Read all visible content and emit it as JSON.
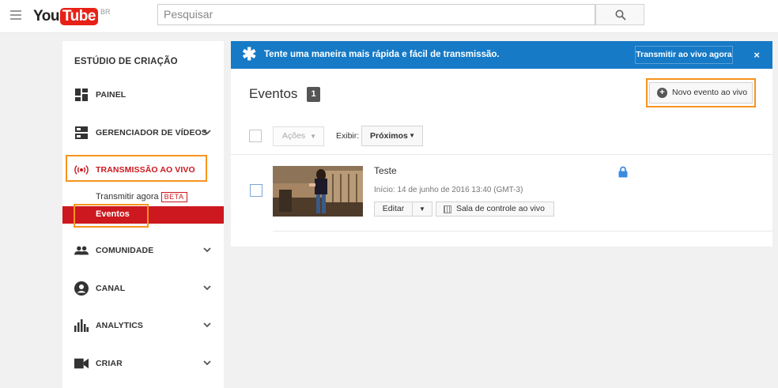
{
  "header": {
    "logo_you": "You",
    "logo_tube": "Tube",
    "logo_country": "BR",
    "search_placeholder": "Pesquisar"
  },
  "sidebar": {
    "title": "ESTÚDIO DE CRIAÇÃO",
    "items": [
      {
        "label": "PAINEL",
        "icon": "dashboard-icon",
        "chevron": false
      },
      {
        "label": "GERENCIADOR DE VÍDEOS",
        "icon": "video-manager-icon",
        "chevron": true
      },
      {
        "label": "TRANSMISSÃO AO VIVO",
        "icon": "live-broadcast-icon",
        "chevron": false,
        "active": true
      },
      {
        "label": "COMUNIDADE",
        "icon": "community-icon",
        "chevron": true
      },
      {
        "label": "CANAL",
        "icon": "channel-icon",
        "chevron": true
      },
      {
        "label": "ANALYTICS",
        "icon": "analytics-icon",
        "chevron": true
      },
      {
        "label": "CRIAR",
        "icon": "create-icon",
        "chevron": true
      }
    ],
    "sub_items": [
      {
        "label": "Transmitir agora",
        "badge": "BETA"
      },
      {
        "label": "Eventos",
        "active": true
      }
    ]
  },
  "banner": {
    "message": "Tente uma maneira mais rápida e fácil de transmissão.",
    "button": "Transmitir ao vivo agora",
    "close": "×"
  },
  "events": {
    "title": "Eventos",
    "count": "1",
    "new_button": "Novo evento ao vivo",
    "actions": "Ações",
    "show_label": "Exibir:",
    "show_value": "Próximos",
    "items": [
      {
        "title": "Teste",
        "start": "Início: 14 de junho de 2016 13:40 (GMT-3)",
        "edit": "Editar",
        "control_room": "Sala de controle ao vivo"
      }
    ]
  },
  "colors": {
    "brand_red": "#cc181e",
    "banner_blue": "#167ac6",
    "highlight_orange": "#f7941d"
  }
}
